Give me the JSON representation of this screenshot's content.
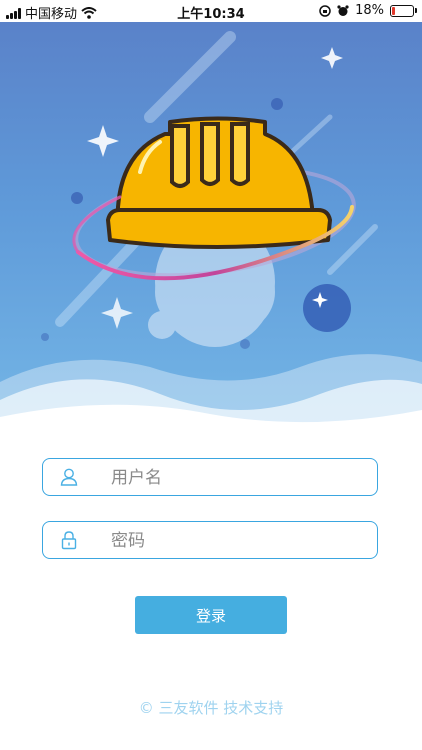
{
  "status_bar": {
    "carrier": "中国移动",
    "time": "上午10:34",
    "battery_text": "18%",
    "battery_level": 0.18,
    "battery_color": "#e23a2c"
  },
  "login_form": {
    "username_placeholder": "用户名",
    "password_placeholder": "密码",
    "login_label": "登录"
  },
  "footer": {
    "copyright_symbol": "©",
    "text": "三友软件 技术支持"
  },
  "colors": {
    "accent": "#45aee0",
    "field_border": "#3aa6e0",
    "helmet": "#f7b500"
  },
  "icons": {
    "user": "user-icon",
    "lock": "lock-icon",
    "hero": "safety-helmet-icon"
  }
}
